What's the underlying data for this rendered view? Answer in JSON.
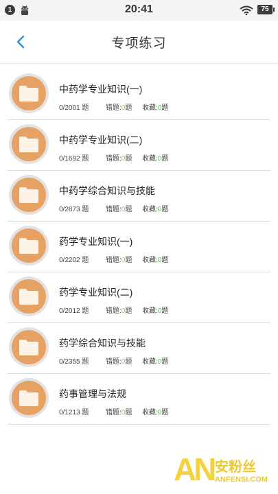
{
  "status_bar": {
    "notification_count": "1",
    "time": "20:41",
    "battery": "75",
    "icons": [
      "notification-badge",
      "android-icon",
      "wifi-icon",
      "battery-icon"
    ]
  },
  "header": {
    "title": "专项练习",
    "back_icon": "chevron-left-icon",
    "back_color": "#2b8fe0"
  },
  "labels": {
    "wrong": "错题:",
    "favorites": "收藏:",
    "unit": "题"
  },
  "items": [
    {
      "title": "中药学专业知识(一)",
      "progress": "0/2001",
      "wrong": "0",
      "favorites": "0"
    },
    {
      "title": "中药学专业知识(二)",
      "progress": "0/1692",
      "wrong": "0",
      "favorites": "0"
    },
    {
      "title": "中药学综合知识与技能",
      "progress": "0/2873",
      "wrong": "0",
      "favorites": "0"
    },
    {
      "title": "药学专业知识(一)",
      "progress": "0/2202",
      "wrong": "0",
      "favorites": "0"
    },
    {
      "title": "药学专业知识(二)",
      "progress": "0/2012",
      "wrong": "0",
      "favorites": "0"
    },
    {
      "title": "药学综合知识与技能",
      "progress": "0/2355",
      "wrong": "0",
      "favorites": "0"
    },
    {
      "title": "药事管理与法规",
      "progress": "0/1213",
      "wrong": "0",
      "favorites": "0"
    }
  ],
  "colors": {
    "folder_bg": "#e6a164",
    "wrong_count": "#f0a030",
    "favorite_count": "#5cb85c",
    "watermark": "#f3d23d"
  },
  "watermark": {
    "logo": "AN",
    "cn": "安粉丝",
    "en": "ANFENSI.COM"
  }
}
